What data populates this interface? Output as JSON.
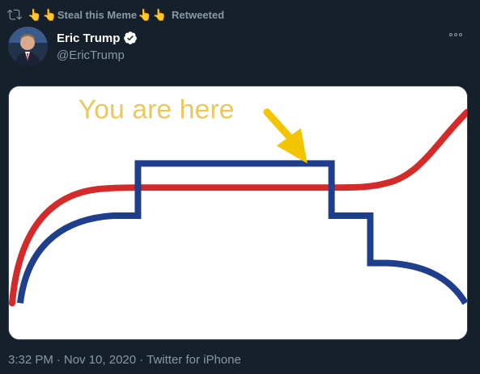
{
  "social_context": {
    "hand_emoji": "👆",
    "retweeter_name": "Steal this Meme",
    "action": "Retweeted"
  },
  "author": {
    "display_name": "Eric Trump",
    "handle": "@EricTrump",
    "verified": true
  },
  "media": {
    "caption": "You are here",
    "colors": {
      "background": "#ffffff",
      "red_line": "#d42a2a",
      "blue_line": "#1f3f8c",
      "arrow": "#f2c500",
      "caption": "#eac85f"
    }
  },
  "meta": {
    "time": "3:32 PM",
    "separator": "·",
    "date": "Nov 10, 2020",
    "source": "Twitter for iPhone"
  },
  "theme": {
    "background": "#15202b",
    "secondary_text": "#8899a6",
    "verified_blue": "#ffffff"
  }
}
